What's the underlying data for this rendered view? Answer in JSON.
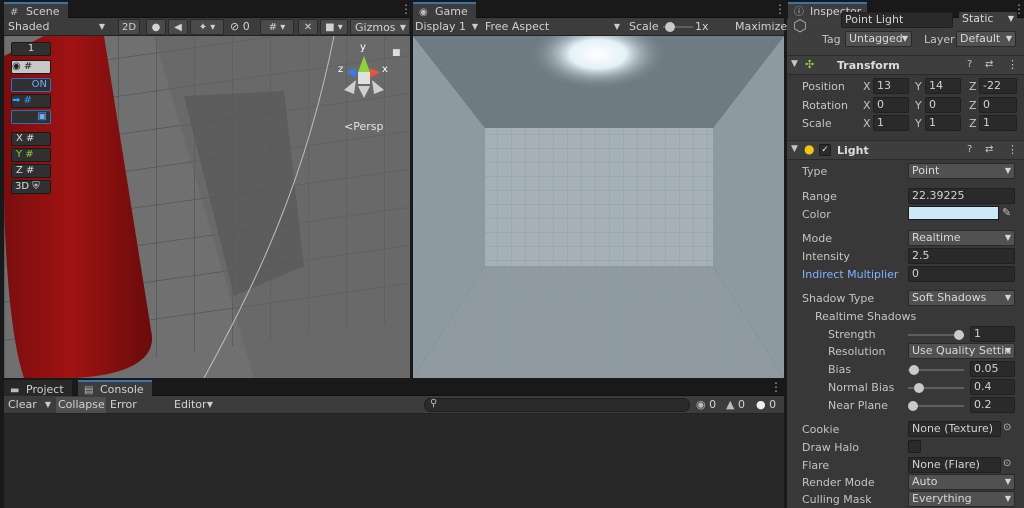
{
  "scene": {
    "tab_label": "Scene",
    "shading_mode": "Shaded",
    "mode_2d": "2D",
    "hidden_count": "0",
    "gizmos_label": "Gizmos",
    "persp_label": "Persp",
    "overlay": {
      "grid_value": "1",
      "snap_toggle": "ON",
      "axis_x": "X",
      "axis_y": "Y",
      "axis_z": "Z",
      "mode_3d": "3D"
    },
    "gizmo_axes": {
      "x": "x",
      "y": "y",
      "z": "z"
    }
  },
  "game": {
    "tab_label": "Game",
    "display": "Display 1",
    "aspect": "Free Aspect",
    "scale_label": "Scale",
    "scale_value": "1x",
    "maximize_label": "Maximize"
  },
  "bottom": {
    "project_tab": "Project",
    "console_tab": "Console",
    "clear": "Clear",
    "collapse": "Collapse",
    "error_pause": "Error Pause",
    "editor": "Editor",
    "count_log": "0",
    "count_warn": "0",
    "count_error": "0"
  },
  "inspector": {
    "tab_label": "Inspector",
    "object_name": "Point Light",
    "static_label": "Static",
    "tag_label": "Tag",
    "tag_value": "Untagged",
    "layer_label": "Layer",
    "layer_value": "Default",
    "transform": {
      "title": "Transform",
      "position_label": "Position",
      "rotation_label": "Rotation",
      "scale_label": "Scale",
      "axis_x": "X",
      "axis_y": "Y",
      "axis_z": "Z",
      "position": {
        "x": "13",
        "y": "14",
        "z": "-22"
      },
      "rotation": {
        "x": "0",
        "y": "0",
        "z": "0"
      },
      "scale": {
        "x": "1",
        "y": "1",
        "z": "1"
      }
    },
    "light": {
      "title": "Light",
      "type_label": "Type",
      "type_value": "Point",
      "range_label": "Range",
      "range_value": "22.39225",
      "color_label": "Color",
      "color_swatch": "#cbe9f7",
      "mode_label": "Mode",
      "mode_value": "Realtime",
      "intensity_label": "Intensity",
      "intensity_value": "2.5",
      "indirect_label": "Indirect Multiplier",
      "indirect_value": "0",
      "shadow_type_label": "Shadow Type",
      "shadow_type_value": "Soft Shadows",
      "realtime_shadows_label": "Realtime Shadows",
      "strength_label": "Strength",
      "strength_value": "1",
      "strength_fraction": 1.0,
      "resolution_label": "Resolution",
      "resolution_value": "Use Quality Settin",
      "bias_label": "Bias",
      "bias_value": "0.05",
      "bias_fraction": 0.025,
      "normal_bias_label": "Normal Bias",
      "normal_bias_value": "0.4",
      "normal_bias_fraction": 0.13,
      "near_plane_label": "Near Plane",
      "near_plane_value": "0.2",
      "near_plane_fraction": 0.0,
      "cookie_label": "Cookie",
      "cookie_value": "None (Texture)",
      "draw_halo_label": "Draw Halo",
      "flare_label": "Flare",
      "flare_value": "None (Flare)",
      "render_mode_label": "Render Mode",
      "render_mode_value": "Auto",
      "culling_mask_label": "Culling Mask",
      "culling_mask_value": "Everything"
    }
  },
  "colors": {
    "accent": "#3a72b0",
    "link": "#7fb3ff",
    "axis_x": "#e8533a",
    "axis_y": "#8cd33c",
    "axis_z": "#3b7be0"
  }
}
